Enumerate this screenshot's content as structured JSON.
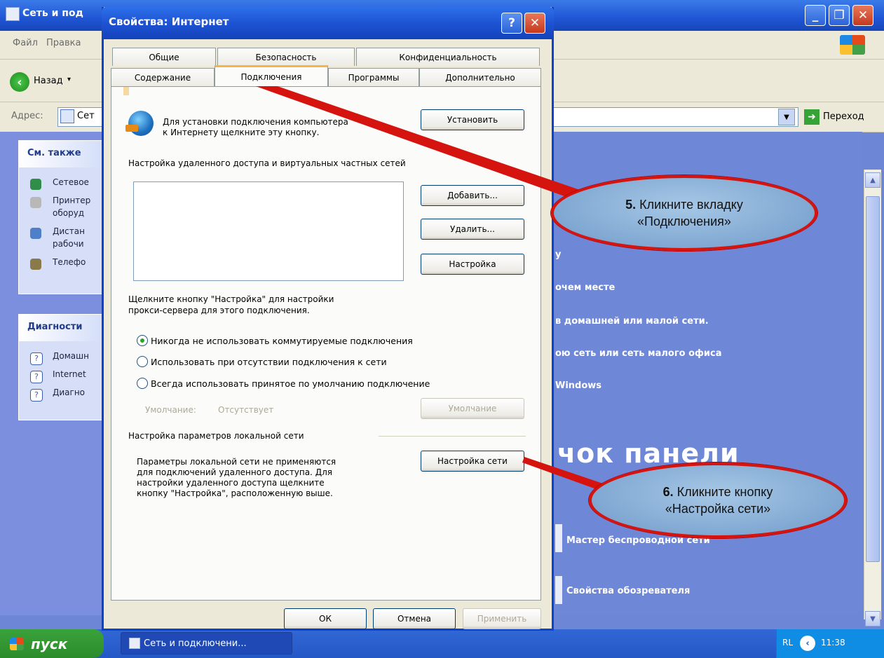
{
  "background_window": {
    "title": "Сеть и под",
    "menu": [
      "Файл",
      "Правка"
    ],
    "back_label": "Назад",
    "address_label": "Адрес:",
    "address_value": "Сет",
    "go_label": "Переход",
    "taskpane": {
      "see_also": {
        "title": "См. также",
        "items": [
          "Сетевое",
          "Принтер",
          "оборуд",
          "Дистан",
          "рабочи",
          "Телефо"
        ]
      },
      "diagnostics": {
        "title": "Диагности",
        "items": [
          "Домашн",
          "Internet",
          "Диагно"
        ]
      }
    },
    "content_lines": [
      "у",
      "очем месте",
      "в домашней или малой сети.",
      "ою сеть или сеть малого офиса",
      "Windows",
      "Мастер беспроводной сети",
      "Свойства обозревателя"
    ],
    "big_heading": "чок панели"
  },
  "dialog": {
    "title": "Свойства: Интернет",
    "tabs_row1": [
      "Общие",
      "Безопасность",
      "Конфиденциальность"
    ],
    "tabs_row2": [
      "Содержание",
      "Подключения",
      "Программы",
      "Дополнительно"
    ],
    "active_tab": "Подключения",
    "setup_text_line1": "Для установки подключения компьютера",
    "setup_text_line2": "к Интернету щелкните эту кнопку.",
    "setup_button": "Установить",
    "dialup_heading": "Настройка удаленного доступа и виртуальных частных сетей",
    "add_button": "Добавить...",
    "remove_button": "Удалить...",
    "settings_button": "Настройка",
    "proxy_text_line1": "Щелкните кнопку \"Настройка\" для настройки",
    "proxy_text_line2": "прокси-сервера для этого подключения.",
    "radio_options": [
      "Никогда не использовать коммутируемые подключения",
      "Использовать при отсутствии подключения к сети",
      "Всегда использовать принятое по умолчанию подключение"
    ],
    "selected_radio": 0,
    "default_label": "Умолчание:",
    "default_value": "Отсутствует",
    "default_button": "Умолчание",
    "lan_heading": "Настройка параметров локальной сети",
    "lan_text": [
      "Параметры локальной сети не применяются",
      "для подключений удаленного доступа. Для",
      "настройки удаленного доступа щелкните",
      "кнопку \"Настройка\", расположенную выше."
    ],
    "lan_button": "Настройка сети",
    "ok_button": "ОК",
    "cancel_button": "Отмена",
    "apply_button": "Применить"
  },
  "callouts": {
    "step5_number": "5.",
    "step5_line1": "Кликните вкладку",
    "step5_line2": "«Подключения»",
    "step6_number": "6.",
    "step6_line1": "Кликните кнопку",
    "step6_line2": "«Настройка сети»"
  },
  "taskbar": {
    "start_label": "пуск",
    "task_label": "Сеть и подключени...",
    "lang": "RL",
    "clock": "11:38"
  },
  "colors": {
    "xp_blue": "#1f55d4",
    "callout_border": "#d6140f",
    "callout_fill": "#7aa3cf",
    "start_green": "#3aa23a"
  }
}
